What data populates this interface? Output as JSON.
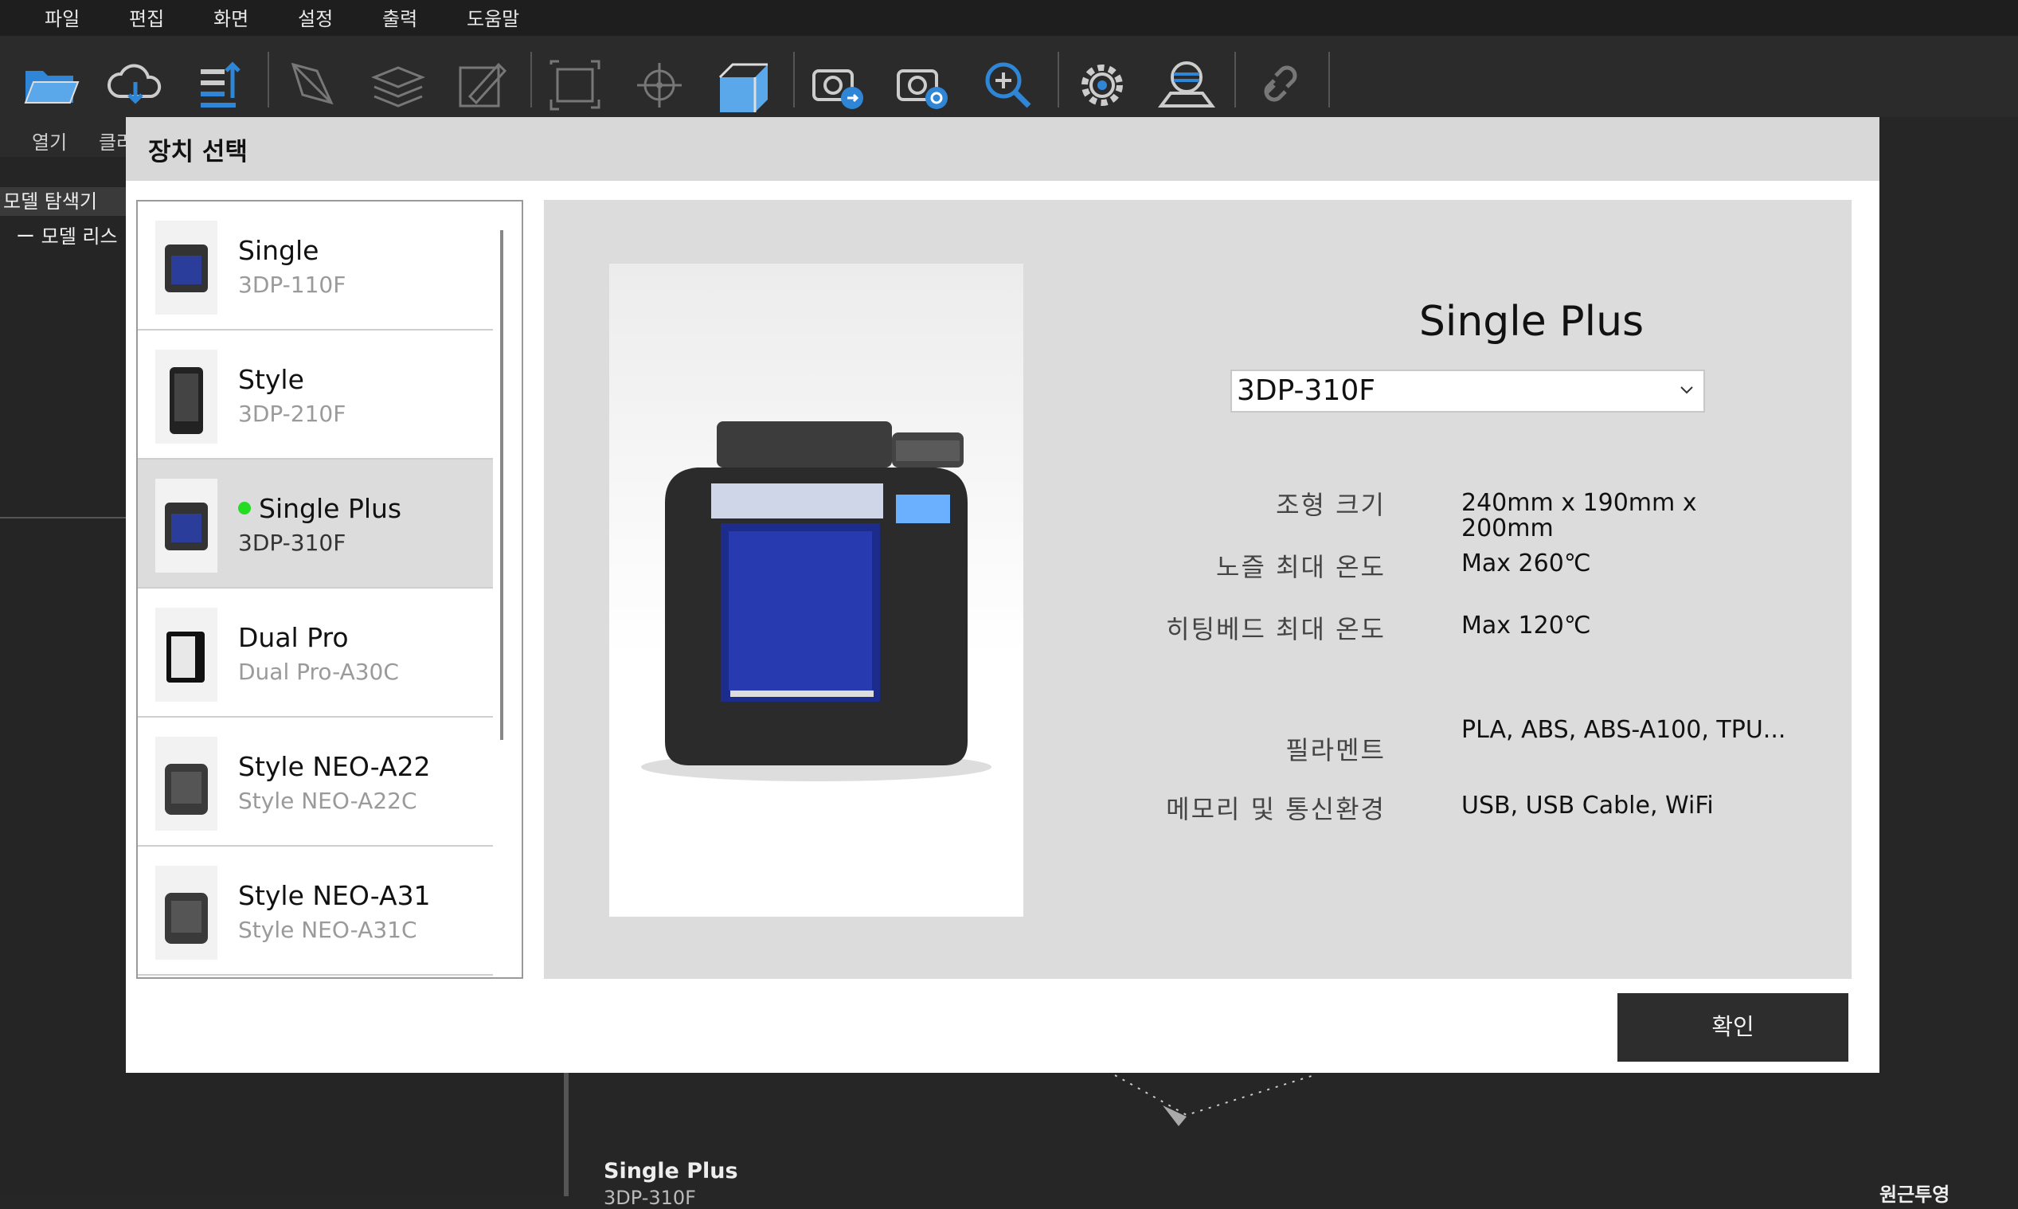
{
  "menubar": {
    "items": [
      "파일",
      "편집",
      "화면",
      "설정",
      "출력",
      "도움말"
    ]
  },
  "toolbar": {
    "labels": [
      "열기",
      "클라"
    ],
    "icons": [
      "open-folder-icon",
      "cloud-download-icon",
      "export-icon",
      "transform-icon",
      "layers-icon",
      "edit-model-icon",
      "select-frame-icon",
      "center-icon",
      "view-3d-icon",
      "camera-rotate-icon",
      "camera-refresh-icon",
      "zoom-in-icon",
      "settings-gear-icon",
      "printer-bed-icon",
      "link-icon"
    ]
  },
  "left_panel": {
    "title": "모델 탐색기",
    "tree_item": "ー 모델 리스"
  },
  "viewport": {
    "printer_title": "Single Plus",
    "printer_sub": "3DP-310F",
    "bottom_right_label": "원근투영"
  },
  "dialog": {
    "title": "장치 선택",
    "devices": [
      {
        "name": "Single",
        "model": "3DP-110F",
        "selected": false
      },
      {
        "name": "Style",
        "model": "3DP-210F",
        "selected": false
      },
      {
        "name": "Single Plus",
        "model": "3DP-310F",
        "selected": true
      },
      {
        "name": "Dual Pro",
        "model": "Dual Pro-A30C",
        "selected": false
      },
      {
        "name": "Style NEO-A22",
        "model": "Style NEO-A22C",
        "selected": false
      },
      {
        "name": "Style NEO-A31",
        "model": "Style NEO-A31C",
        "selected": false
      }
    ],
    "detail": {
      "device_name": "Single Plus",
      "model_select": "3DP-310F",
      "specs": [
        {
          "label": "조형 크기",
          "value": "240mm x 190mm x 200mm"
        },
        {
          "label": "노즐 최대 온도",
          "value": "Max 260℃"
        },
        {
          "label": "히팅베드 최대 온도",
          "value": "Max 120℃"
        },
        {
          "label": "필라멘트",
          "value": "PLA, ABS, ABS-A100, TPU..."
        },
        {
          "label": "메모리 및 통신환경",
          "value": "USB, USB Cable, WiFi"
        }
      ]
    },
    "ok_label": "확인"
  },
  "colors": {
    "accent_blue": "#2f86d6",
    "selected_dot": "#22dd22",
    "selected_row": "#dcdcdc",
    "ok_button": "#2d2d2d"
  }
}
